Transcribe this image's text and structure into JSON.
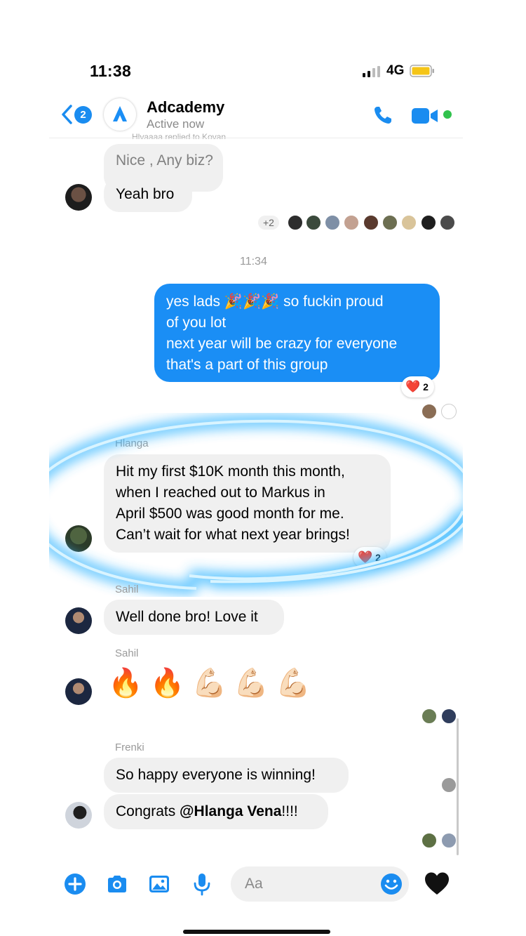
{
  "status_bar": {
    "time": "11:38",
    "network": "4G"
  },
  "header": {
    "back_badge": "2",
    "group_name": "Adcademy",
    "group_status": "Active now",
    "truncated_line": "Hlyaaaa replied to Kovan"
  },
  "icons": {
    "back": "chevron-left-icon",
    "call": "phone-icon",
    "video": "video-camera-icon",
    "plus": "plus-circle-icon",
    "camera": "camera-icon",
    "gallery": "image-icon",
    "mic": "microphone-icon",
    "emoji": "smiley-icon",
    "like": "black-heart-icon"
  },
  "colors": {
    "accent": "#1a8ef5",
    "bubble_in": "#f0f0f0",
    "active": "#31c24d",
    "glow": "#6fd0ff",
    "reaction": "#e0182d"
  },
  "messages": {
    "m1": {
      "text": "Nice , Any biz?"
    },
    "m2": {
      "text": "Yeah bro"
    },
    "read_receipts_more": "+2",
    "timestamp": "11:34",
    "m3": {
      "lines": [
        "yes lads 🎉🎉🎉 so fuckin proud",
        "of you lot",
        "next year will be crazy for everyone",
        "that's a part of this group"
      ]
    },
    "m3_reaction": {
      "emoji": "❤️",
      "count": "2"
    },
    "m4": {
      "sender": "Hlanga",
      "lines": [
        "Hit my first $10K month this month,",
        "when I reached out to Markus in",
        "April $500 was good month for me.",
        "Can’t wait for what next year brings!"
      ]
    },
    "m4_reaction": {
      "emoji": "❤️",
      "count": "2"
    },
    "m5": {
      "sender": "Sahil",
      "text": "Well done bro! Love it"
    },
    "m6": {
      "sender": "Sahil",
      "emojis": "🔥🔥💪🏻💪🏻💪🏻"
    },
    "m7": {
      "sender": "Frenki",
      "text": "So happy everyone is winning!"
    },
    "m8": {
      "prefix": "Congrats ",
      "mention": "@Hlanga Vena",
      "suffix": "!!!!"
    }
  },
  "composer": {
    "placeholder": "Aa"
  }
}
